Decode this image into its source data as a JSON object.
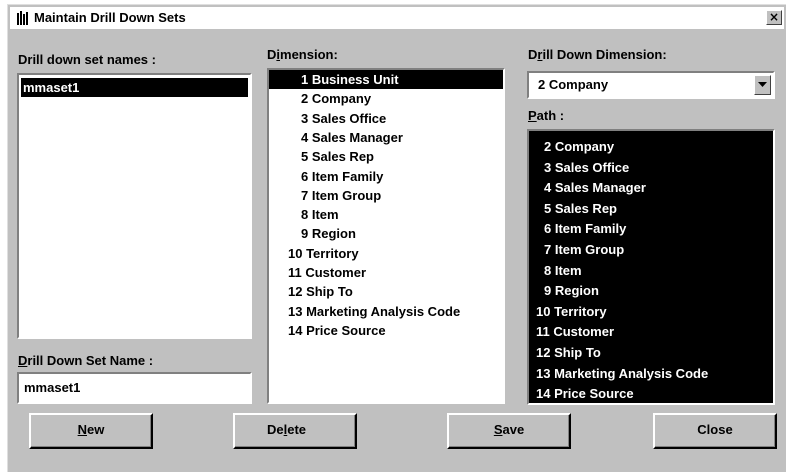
{
  "window": {
    "title": "Maintain Drill Down Sets",
    "close_glyph": "×",
    "icon": "app-icon"
  },
  "labels": {
    "set_names_label": "Drill down set names :",
    "dimension_label": {
      "pre": "D",
      "ul": "i",
      "post": "mension:"
    },
    "drill_dim_label": {
      "pre": "D",
      "ul": "r",
      "post": "ill Down Dimension:"
    },
    "path_label": {
      "ul": "P",
      "post": "ath :"
    },
    "set_name_label": {
      "ul": "D",
      "post": "rill Down Set Name :"
    }
  },
  "set_names": [
    {
      "label": "mmaset1",
      "selected": true
    }
  ],
  "dimensions": [
    {
      "label": "1 Business Unit",
      "selected": true
    },
    {
      "label": "2 Company"
    },
    {
      "label": "3 Sales Office"
    },
    {
      "label": "4 Sales Manager"
    },
    {
      "label": "5 Sales Rep"
    },
    {
      "label": "6 Item Family"
    },
    {
      "label": "7 Item Group"
    },
    {
      "label": "8 Item"
    },
    {
      "label": "9 Region"
    },
    {
      "label": "10 Territory"
    },
    {
      "label": "11 Customer"
    },
    {
      "label": "12 Ship To"
    },
    {
      "label": "13 Marketing Analysis Code"
    },
    {
      "label": "14 Price Source"
    }
  ],
  "drill_down_dimension": {
    "value": "2 Company"
  },
  "path": [
    {
      "label": "2 Company"
    },
    {
      "label": "3 Sales Office"
    },
    {
      "label": "4 Sales Manager"
    },
    {
      "label": "5 Sales Rep"
    },
    {
      "label": "6 Item Family"
    },
    {
      "label": "7 Item Group"
    },
    {
      "label": "8 Item"
    },
    {
      "label": "9 Region"
    },
    {
      "label": "10 Territory"
    },
    {
      "label": "11 Customer"
    },
    {
      "label": "12 Ship To"
    },
    {
      "label": "13 Marketing Analysis Code"
    },
    {
      "label": "14 Price Source"
    }
  ],
  "set_name_input": {
    "value": "mmaset1"
  },
  "buttons": {
    "new": {
      "ul": "N",
      "post": "ew"
    },
    "delete": {
      "pre": "De",
      "ul": "l",
      "post": "ete"
    },
    "save": {
      "ul": "S",
      "post": "ave"
    },
    "close": {
      "label": "Close"
    }
  },
  "colors": {
    "face": "#c0c0c0",
    "selection": "#000000",
    "window": "#ffffff"
  }
}
